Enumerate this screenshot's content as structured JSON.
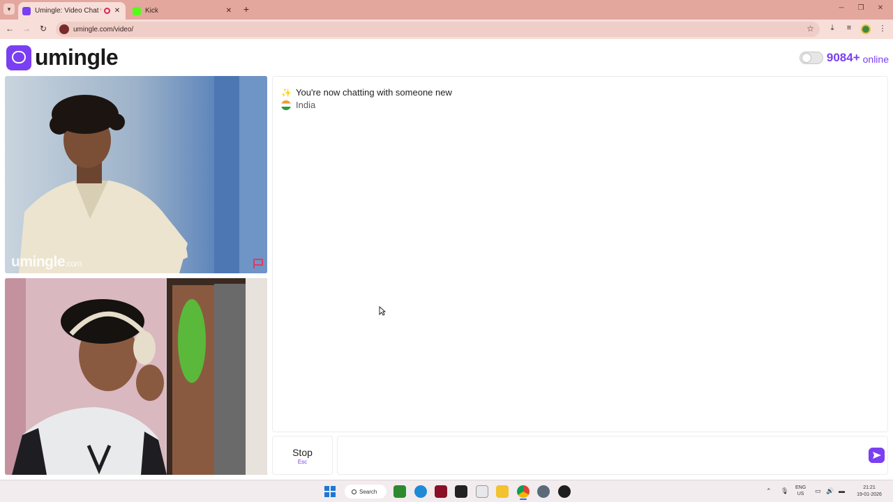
{
  "browser": {
    "tabs": [
      {
        "title": "Umingle: Video Chat with Str",
        "active": true
      },
      {
        "title": "Kick",
        "active": false
      }
    ],
    "url": "umingle.com/video/"
  },
  "header": {
    "logo_text": "umingle",
    "online_count": "9084+",
    "online_label": "online"
  },
  "video": {
    "watermark": "umingle",
    "watermark_suffix": ".com"
  },
  "chat": {
    "system_message": "You're now chatting with someone new",
    "country": "India"
  },
  "controls": {
    "stop_label": "Stop",
    "stop_shortcut": "Esc",
    "message_placeholder": ""
  },
  "taskbar": {
    "search_label": "Search",
    "lang_line1": "ENG",
    "lang_line2": "US",
    "time": "21:21",
    "date": "19-01-2026"
  },
  "colors": {
    "accent": "#7a3ff2",
    "tabbar": "#e3a79d",
    "toolbar": "#f7ded9"
  }
}
